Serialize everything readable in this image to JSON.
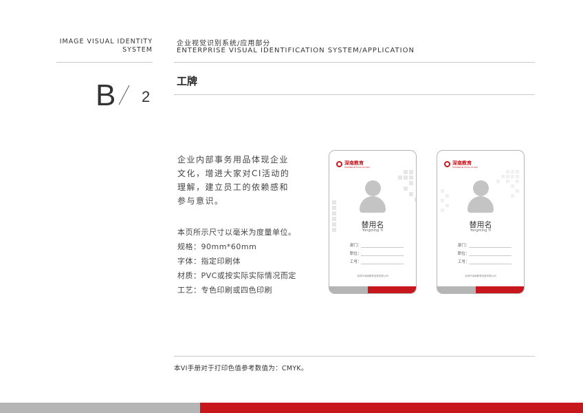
{
  "header": {
    "left_en_line1": "IMAGE VISUAL IDENTITY",
    "left_en_line2": "SYSTEM",
    "title_cn": "企业视觉识别系统/应用部分",
    "title_en": "ENTERPRISE VISUAL IDENTIFICATION SYSTEM/APPLICATION"
  },
  "section": {
    "letter": "B",
    "number": "2",
    "title": "工牌"
  },
  "description": "企业内部事务用品体现企业文化，增进大家对CI活动的理解，建立员工的依赖感和参与意识。",
  "notes": [
    "本页所示尺寸以毫米为度量单位。",
    "规格：90mm*60mm",
    "字体：指定印刷体",
    "材质：PVC或按实际实际情况而定",
    "工艺：专色印刷或四色印刷"
  ],
  "badge": {
    "logo_text": "深南教育",
    "logo_sub": "SHENNAN EDUCATION",
    "name_cn": "替用名",
    "name_en": "Yongming Ti",
    "fields": [
      "部门：",
      "职位：",
      "工号："
    ],
    "company": "深圳市深南教育信息有限公司"
  },
  "footer_note": "本VI手册对于打印色值参考数值为：CMYK。",
  "colors": {
    "brand_red": "#c8161d",
    "grey": "#b5b5b5"
  }
}
